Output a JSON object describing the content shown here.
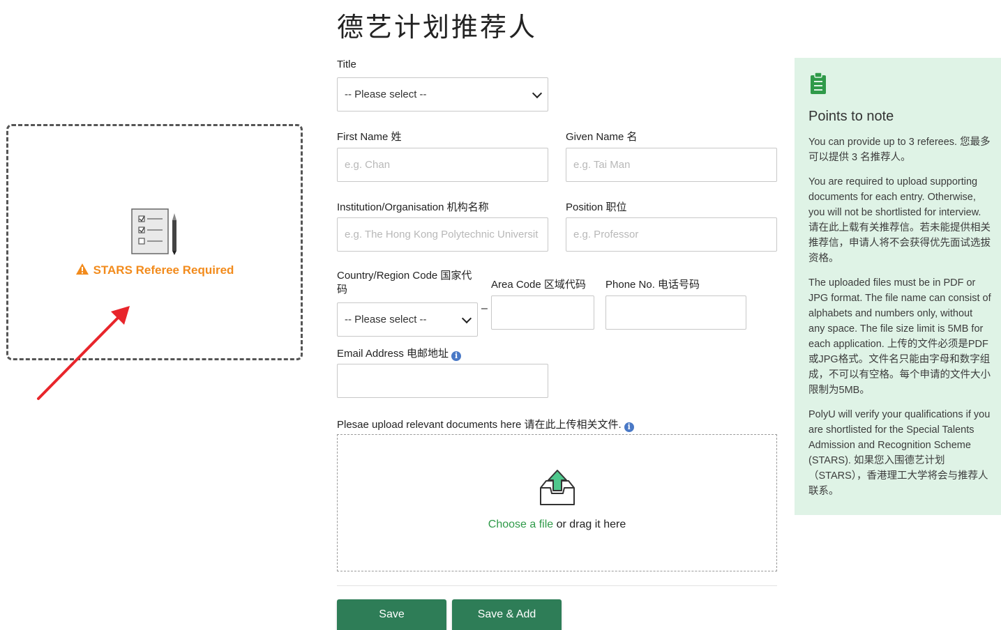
{
  "page": {
    "title": "德艺计划推荐人"
  },
  "form": {
    "title_label": "Title",
    "title_select": "-- Please select --",
    "first_name_label": "First Name 姓",
    "first_name_placeholder": "e.g. Chan",
    "given_name_label": "Given Name 名",
    "given_name_placeholder": "e.g. Tai Man",
    "institution_label": "Institution/Organisation 机构名称",
    "institution_placeholder": "e.g. The Hong Kong Polytechnic Universit",
    "position_label": "Position 职位",
    "position_placeholder": "e.g. Professor",
    "country_code_label": "Country/Region Code 国家代码",
    "country_code_select": "-- Please select --",
    "dash": "–",
    "area_code_label": "Area Code 区域代码",
    "phone_label": "Phone No. 电话号码",
    "email_label": "Email Address 电邮地址",
    "upload_label": "Plesae upload relevant documents here 请在此上传相关文件.",
    "dropzone": {
      "link_text": "Choose a file",
      "rest_text": " or drag it here"
    },
    "save_button": "Save",
    "save_add_button": "Save & Add"
  },
  "notes": {
    "title": "Points to note",
    "paragraphs": [
      "You can provide up to 3 referees. 您最多可以提供 3 名推荐人。",
      "You are required to upload supporting documents for each entry. Otherwise, you will not be shortlisted for interview. 请在此上载有关推荐信。若未能提供相关推荐信，申请人将不会获得优先面试选拔资格。",
      "The uploaded files must be in PDF or JPG format. The file name can consist of alphabets and numbers only, without any space. The file size limit is 5MB for each application. 上传的文件必须是PDF或JPG格式。文件名只能由字母和数字组成，不可以有空格。每个申请的文件大小限制为5MB。",
      "PolyU will verify your qualifications if you are shortlisted for the Special Talents Admission and Recognition Scheme (STARS). 如果您入围德艺计划（STARS），香港理工大学将会与推荐人联系。"
    ]
  },
  "referee_card": {
    "warning": "STARS Referee Required"
  },
  "colors": {
    "primary_green": "#2e7d57",
    "link_green": "#2f9a49",
    "notes_bg": "#dff3e6",
    "warning_orange": "#f28b1c",
    "arrow_red": "#e8252b",
    "info_blue": "#4a79c6"
  }
}
